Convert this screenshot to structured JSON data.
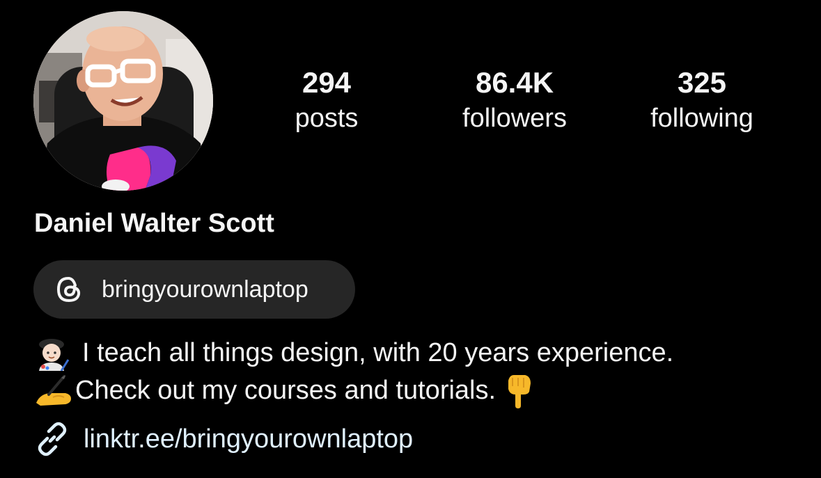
{
  "profile": {
    "display_name": "Daniel Walter Scott",
    "avatar_icon": "profile-photo"
  },
  "stats": {
    "posts": {
      "value": "294",
      "label": "posts"
    },
    "followers": {
      "value": "86.4K",
      "label": "followers"
    },
    "following": {
      "value": "325",
      "label": "following"
    }
  },
  "threads": {
    "icon": "threads-icon",
    "handle": "bringyourownlaptop"
  },
  "bio": {
    "line1": {
      "emoji_icon": "artist-emoji",
      "text": "I teach all things design, with 20 years experience."
    },
    "line2": {
      "emoji_icon": "writing-hand-emoji",
      "text": "Check out my courses and tutorials.",
      "trailing_emoji_icon": "pointing-down-emoji"
    }
  },
  "link": {
    "icon": "link-icon",
    "text": "linktr.ee/bringyourownlaptop"
  },
  "colors": {
    "background": "#000000",
    "text": "#f5f5f5",
    "chip_background": "#262626",
    "link_text": "#e0f1ff"
  }
}
